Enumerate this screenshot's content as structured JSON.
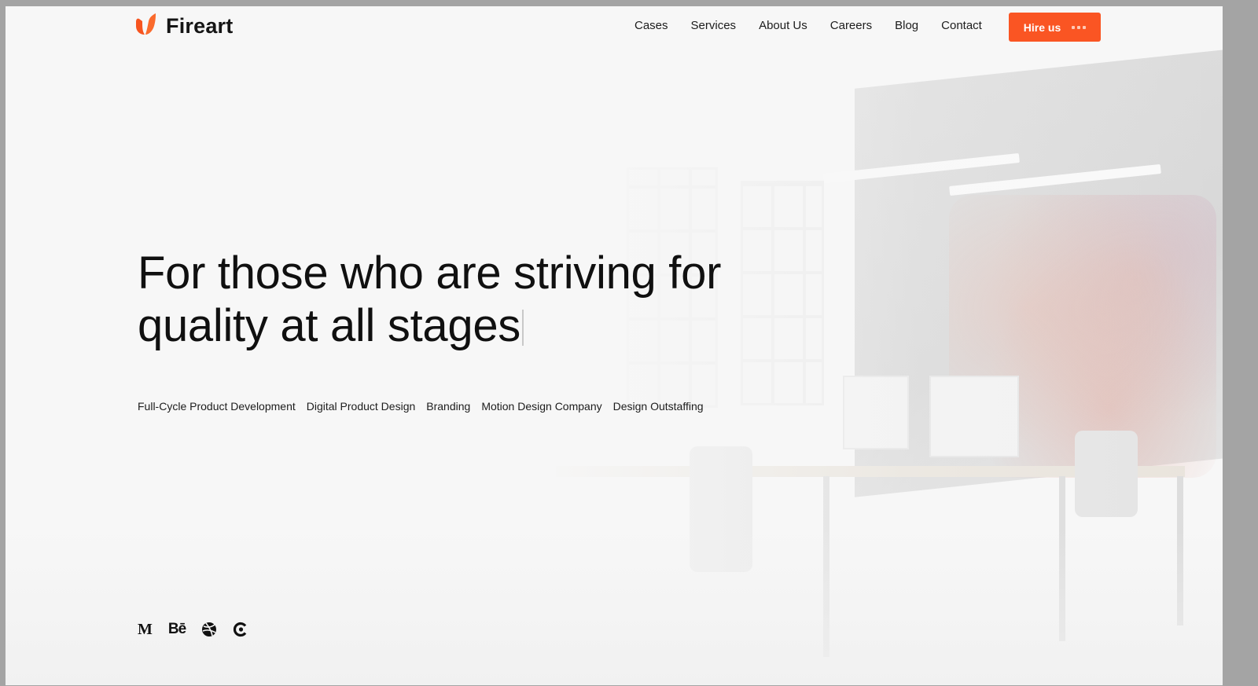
{
  "brand": {
    "name": "Fireart",
    "logo_icon": "flame-u-logo-icon",
    "accent_color": "#fa5523"
  },
  "nav": {
    "items": [
      {
        "label": "Cases"
      },
      {
        "label": "Services"
      },
      {
        "label": "About Us"
      },
      {
        "label": "Careers"
      },
      {
        "label": "Blog"
      },
      {
        "label": "Contact"
      }
    ],
    "cta_label": "Hire us",
    "cta_icon": "dots-icon"
  },
  "hero": {
    "headline_line1": "For those who are striving for",
    "headline_line2": "quality at all stages",
    "services": [
      {
        "label": "Full-Cycle Product Development"
      },
      {
        "label": "Digital Product Design"
      },
      {
        "label": "Branding"
      },
      {
        "label": "Motion Design Company"
      },
      {
        "label": "Design Outstaffing"
      }
    ]
  },
  "social": [
    {
      "name": "medium",
      "icon": "medium-icon",
      "glyph": "M"
    },
    {
      "name": "behance",
      "icon": "behance-icon",
      "glyph": "Bē"
    },
    {
      "name": "dribbble",
      "icon": "dribbble-icon"
    },
    {
      "name": "clutch",
      "icon": "clutch-icon"
    }
  ]
}
